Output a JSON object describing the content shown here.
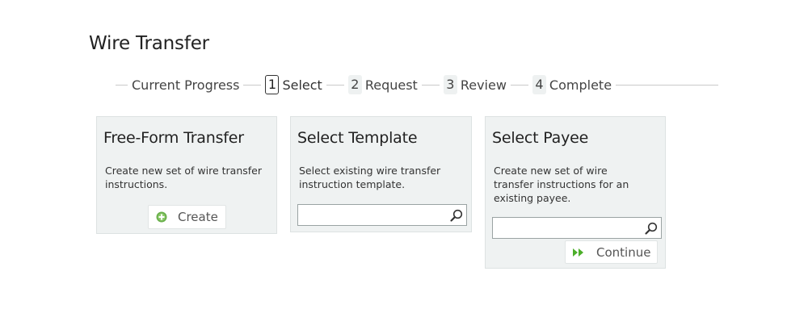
{
  "page": {
    "title": "Wire Transfer"
  },
  "progress": {
    "label": "Current Progress",
    "steps": [
      {
        "number": "1",
        "label": "Select",
        "state": "active"
      },
      {
        "number": "2",
        "label": "Request",
        "state": "inactive"
      },
      {
        "number": "3",
        "label": "Review",
        "state": "inactive"
      },
      {
        "number": "4",
        "label": "Complete",
        "state": "inactive"
      }
    ]
  },
  "panels": {
    "free_form": {
      "title": "Free-Form Transfer",
      "description": "Create new set of wire transfer instructions.",
      "button_label": "Create",
      "button_icon": "plus-circle-icon"
    },
    "template": {
      "title": "Select Template",
      "description": "Select existing wire transfer instruction template.",
      "search_value": "",
      "search_icon": "search-icon"
    },
    "payee": {
      "title": "Select Payee",
      "description": "Create new set of wire transfer instructions for an existing payee.",
      "search_value": "",
      "search_icon": "search-icon",
      "button_label": "Continue",
      "button_icon": "double-chevron-right-icon"
    }
  },
  "colors": {
    "panel_bg": "#eff2f2",
    "create_icon": "#6ab04c",
    "continue_icon": "#4caf2a"
  }
}
